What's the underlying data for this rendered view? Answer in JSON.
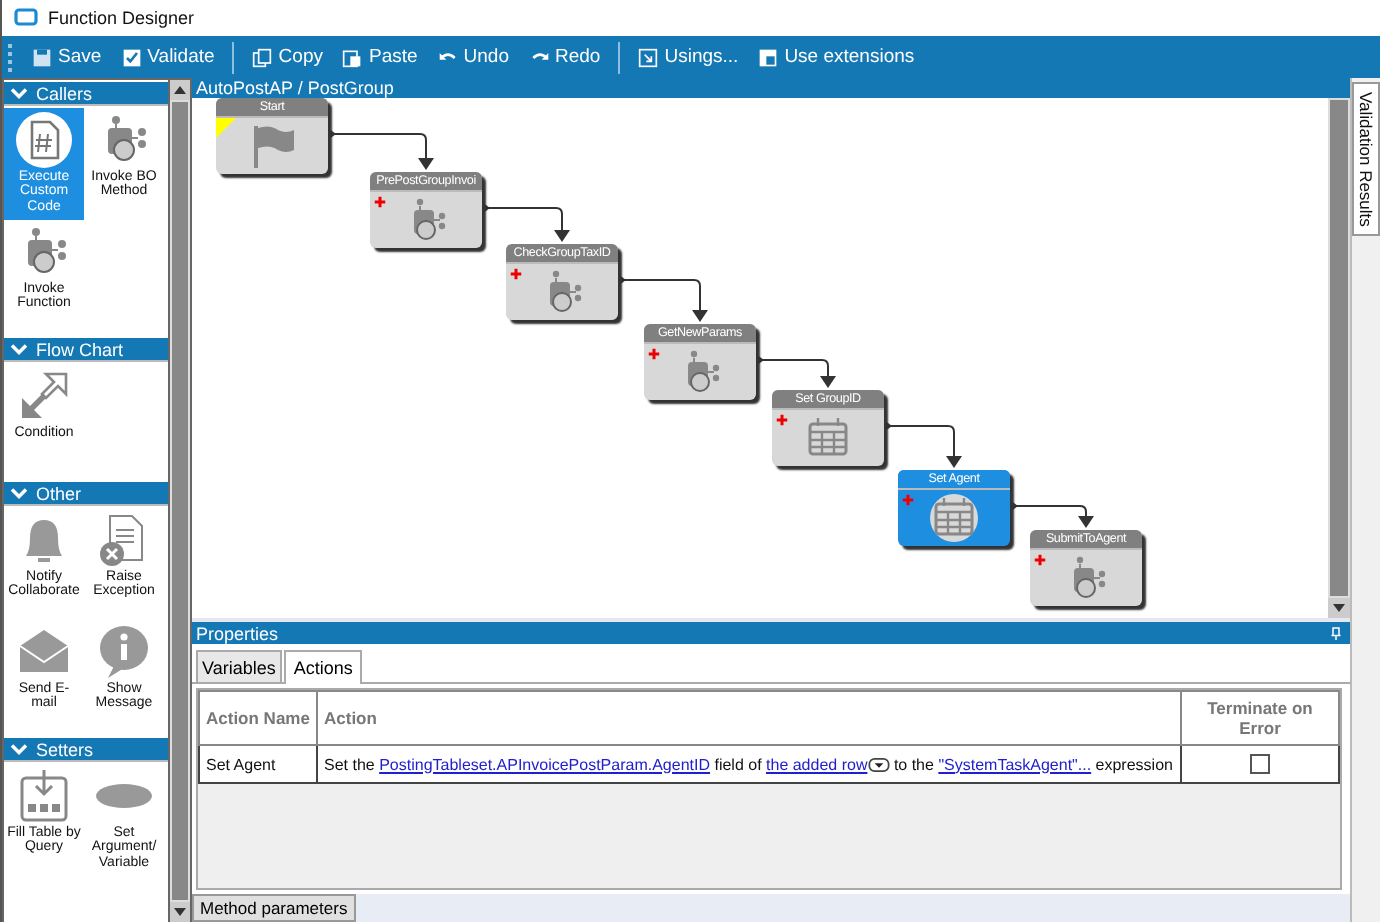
{
  "window": {
    "title": "Function Designer"
  },
  "toolbar": [
    {
      "label": "Save",
      "kind": "save"
    },
    {
      "label": "Validate",
      "kind": "check"
    },
    {
      "label": "Copy",
      "kind": "copy"
    },
    {
      "label": "Paste",
      "kind": "paste"
    },
    {
      "label": "Undo",
      "kind": "undo"
    },
    {
      "label": "Redo",
      "kind": "redo"
    },
    {
      "label": "Usings...",
      "kind": "usings"
    },
    {
      "label": "Use extensions",
      "kind": "ext"
    }
  ],
  "sidebar": {
    "groups": [
      {
        "title": "Callers",
        "expanded": true,
        "items": [
          {
            "label": "Execute Custom Code",
            "kind": "code",
            "selected": true
          },
          {
            "label": "Invoke BO Method",
            "kind": "method",
            "selected": false
          },
          {
            "label": "Invoke Function",
            "kind": "function",
            "selected": false
          }
        ]
      },
      {
        "title": "Flow Chart",
        "expanded": true,
        "items": [
          {
            "label": "Condition",
            "kind": "condition",
            "selected": false
          }
        ]
      },
      {
        "title": "Other",
        "expanded": true,
        "items": [
          {
            "label": "Notify Collaborate",
            "kind": "bell",
            "selected": false
          },
          {
            "label": "Raise Exception",
            "kind": "exception",
            "selected": false
          },
          {
            "label": "Send E-mail",
            "kind": "mail",
            "selected": false
          },
          {
            "label": "Show Message",
            "kind": "info",
            "selected": false
          }
        ]
      },
      {
        "title": "Setters",
        "expanded": true,
        "items": [
          {
            "label": "Fill Table by Query",
            "kind": "filltable",
            "selected": false
          },
          {
            "label": "Set Argument/ Variable",
            "kind": "abc",
            "selected": false
          }
        ]
      }
    ]
  },
  "canvas": {
    "breadcrumb": "AutoPostAP / PostGroup",
    "nodes": [
      {
        "label": "Start",
        "kind": "start",
        "selected": false
      },
      {
        "label": "PrePostGroupInvoi",
        "kind": "method",
        "selected": false
      },
      {
        "label": "CheckGroupTaxID",
        "kind": "method",
        "selected": false
      },
      {
        "label": "GetNewParams",
        "kind": "method",
        "selected": false
      },
      {
        "label": "Set GroupID",
        "kind": "setter",
        "selected": false
      },
      {
        "label": "Set Agent",
        "kind": "setter",
        "selected": true
      },
      {
        "label": "SubmitToAgent",
        "kind": "method",
        "selected": false
      }
    ]
  },
  "side_tab": "Validation Results",
  "properties": {
    "title": "Properties",
    "tabs": [
      {
        "label": "Variables",
        "selected": false
      },
      {
        "label": "Actions",
        "selected": true
      }
    ],
    "columns": [
      "Action Name",
      "Action",
      "Terminate on Error"
    ],
    "rows": [
      {
        "name": "Set Agent",
        "action": [
          {
            "kind": "text",
            "text": "Set the "
          },
          {
            "kind": "link",
            "text": "PostingTableset.APInvoicePostParam.AgentID"
          },
          {
            "kind": "text",
            "text": " field of "
          },
          {
            "kind": "link",
            "text": "the added row"
          },
          {
            "kind": "dropdown"
          },
          {
            "kind": "text",
            "text": " to the "
          },
          {
            "kind": "link",
            "text": "\"SystemTaskAgent\"..."
          },
          {
            "kind": "text",
            "text": " expression"
          }
        ],
        "terminate_on_error": false
      }
    ]
  },
  "bottom_tab": "Method parameters"
}
